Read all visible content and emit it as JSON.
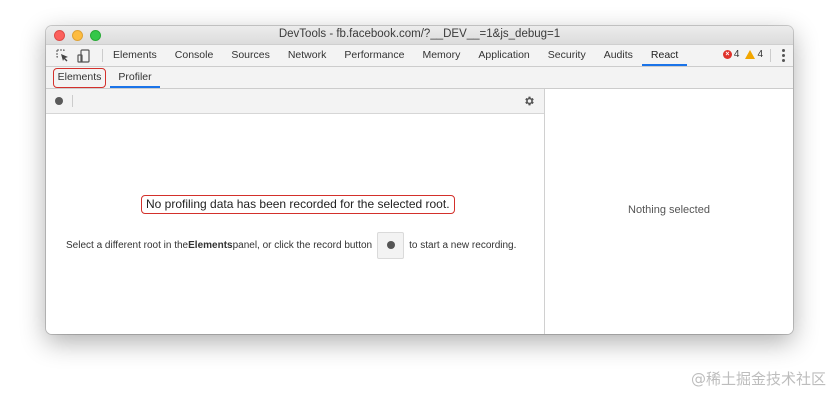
{
  "window": {
    "title": "DevTools - fb.facebook.com/?__DEV__=1&js_debug=1"
  },
  "toolbar": {
    "inspect_icon": "inspect-element-icon",
    "device_icon": "device-toolbar-icon",
    "tabs": [
      {
        "label": "Elements",
        "active": false
      },
      {
        "label": "Console",
        "active": false
      },
      {
        "label": "Sources",
        "active": false
      },
      {
        "label": "Network",
        "active": false
      },
      {
        "label": "Performance",
        "active": false
      },
      {
        "label": "Memory",
        "active": false
      },
      {
        "label": "Application",
        "active": false
      },
      {
        "label": "Security",
        "active": false
      },
      {
        "label": "Audits",
        "active": false
      },
      {
        "label": "React",
        "active": true
      }
    ],
    "error_count": "4",
    "warning_count": "4",
    "menu_icon": "kebab-menu-icon"
  },
  "subtabs": {
    "elements": "Elements",
    "profiler": "Profiler"
  },
  "profiler": {
    "record_icon": "record-icon",
    "settings_icon": "gear-icon",
    "empty_title": "No profiling data has been recorded for the selected root.",
    "desc_prefix": "Select a different root in the ",
    "desc_bold": "Elements",
    "desc_middle": " panel, or click the record button",
    "desc_suffix": "to start a new recording."
  },
  "details": {
    "nothing_selected": "Nothing selected"
  },
  "watermark": "@稀土掘金技术社区",
  "colors": {
    "accent": "#1a73e8",
    "highlight_border": "#d3302b",
    "error": "#e0322b",
    "warning": "#f2a600"
  }
}
